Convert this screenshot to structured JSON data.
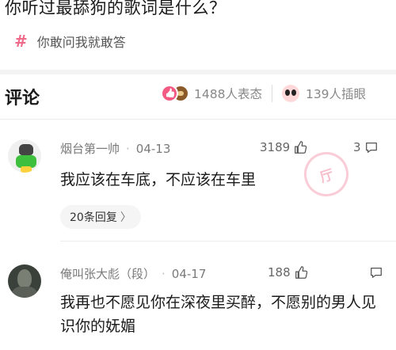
{
  "question": {
    "title": "你听过最舔狗的歌词是什么？",
    "topic_tag": "你敢问我就敢答"
  },
  "comments_header": {
    "title": "评论",
    "reactions_count": "1488人表态",
    "illustrations_count": "139人插眼"
  },
  "comments": [
    {
      "username": "烟台第一帅",
      "date": "04-13",
      "likes": "3189",
      "replies": "3",
      "text": "我应该在车底，不应该在车里",
      "reply_link": "20条回复",
      "reply_chevron": "〉",
      "stamp": "厅"
    },
    {
      "username": "俺叫张大彪（段）",
      "date": "04-17",
      "likes": "188",
      "replies": "",
      "text": "我再也不愿见你在深夜里买醉，不愿别的男人见识你的妩媚"
    }
  ],
  "colors": {
    "accent_pink": "#f25a84",
    "tag_pink": "#f06a8a",
    "muted_text": "#7a7a7a"
  },
  "icons": {
    "topic": "hash-icon",
    "like": "thumb-up-icon",
    "reply": "comment-bubble-icon"
  }
}
